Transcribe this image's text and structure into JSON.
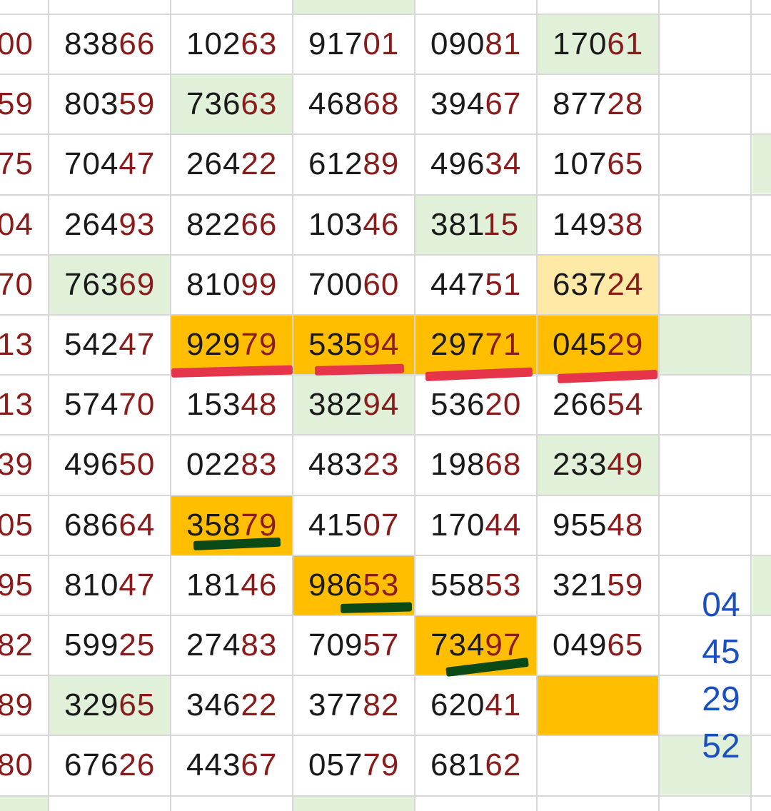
{
  "colors": {
    "grid_line": "#d7d7d7",
    "light_green": "#e1f0d9",
    "light_yellow": "#ffe9a6",
    "orange": "#ffbf00",
    "prefix_text": "#1a1a1a",
    "suffix_text": "#8b1a1a",
    "side_text": "#1a4fbf",
    "red_mark": "#e6354a",
    "green_mark": "#0b4a16"
  },
  "rows": [
    {
      "cells": [
        {
          "pre": "",
          "suf": "00"
        },
        {
          "pre": "838",
          "suf": "66"
        },
        {
          "pre": "102",
          "suf": "63"
        },
        {
          "pre": "917",
          "suf": "01"
        },
        {
          "pre": "090",
          "suf": "81"
        },
        {
          "pre": "170",
          "suf": "61",
          "bg": "light_green"
        }
      ]
    },
    {
      "cells": [
        {
          "pre": "",
          "suf": "59"
        },
        {
          "pre": "803",
          "suf": "59"
        },
        {
          "pre": "736",
          "suf": "63",
          "bg": "light_green"
        },
        {
          "pre": "468",
          "suf": "68"
        },
        {
          "pre": "394",
          "suf": "67"
        },
        {
          "pre": "877",
          "suf": "28"
        }
      ]
    },
    {
      "cells": [
        {
          "pre": "",
          "suf": "75"
        },
        {
          "pre": "704",
          "suf": "47"
        },
        {
          "pre": "264",
          "suf": "22"
        },
        {
          "pre": "612",
          "suf": "89"
        },
        {
          "pre": "496",
          "suf": "34"
        },
        {
          "pre": "107",
          "suf": "65"
        }
      ]
    },
    {
      "cells": [
        {
          "pre": "",
          "suf": "04"
        },
        {
          "pre": "264",
          "suf": "93"
        },
        {
          "pre": "822",
          "suf": "66"
        },
        {
          "pre": "103",
          "suf": "46"
        },
        {
          "pre": "381",
          "suf": "15",
          "bg": "light_green"
        },
        {
          "pre": "149",
          "suf": "38"
        }
      ]
    },
    {
      "cells": [
        {
          "pre": "",
          "suf": "70"
        },
        {
          "pre": "763",
          "suf": "69",
          "bg": "light_green"
        },
        {
          "pre": "810",
          "suf": "99"
        },
        {
          "pre": "700",
          "suf": "60"
        },
        {
          "pre": "447",
          "suf": "51"
        },
        {
          "pre": "637",
          "suf": "24",
          "bg": "light_yellow"
        }
      ]
    },
    {
      "cells": [
        {
          "pre": "",
          "suf": "13"
        },
        {
          "pre": "542",
          "suf": "47"
        },
        {
          "pre": "929",
          "suf": "79",
          "bg": "orange"
        },
        {
          "pre": "535",
          "suf": "94",
          "bg": "orange"
        },
        {
          "pre": "297",
          "suf": "71",
          "bg": "orange"
        },
        {
          "pre": "045",
          "suf": "29",
          "bg": "orange"
        }
      ]
    },
    {
      "cells": [
        {
          "pre": "",
          "suf": "13"
        },
        {
          "pre": "574",
          "suf": "70"
        },
        {
          "pre": "153",
          "suf": "48"
        },
        {
          "pre": "382",
          "suf": "94",
          "bg": "light_green"
        },
        {
          "pre": "536",
          "suf": "20"
        },
        {
          "pre": "266",
          "suf": "54"
        }
      ]
    },
    {
      "cells": [
        {
          "pre": "",
          "suf": "39"
        },
        {
          "pre": "496",
          "suf": "50"
        },
        {
          "pre": "022",
          "suf": "83"
        },
        {
          "pre": "483",
          "suf": "23"
        },
        {
          "pre": "198",
          "suf": "68"
        },
        {
          "pre": "233",
          "suf": "49",
          "bg": "light_green"
        }
      ]
    },
    {
      "cells": [
        {
          "pre": "",
          "suf": "05"
        },
        {
          "pre": "686",
          "suf": "64"
        },
        {
          "pre": "358",
          "suf": "79",
          "bg": "orange"
        },
        {
          "pre": "415",
          "suf": "07"
        },
        {
          "pre": "170",
          "suf": "44"
        },
        {
          "pre": "955",
          "suf": "48"
        }
      ]
    },
    {
      "cells": [
        {
          "pre": "",
          "suf": "95"
        },
        {
          "pre": "810",
          "suf": "47"
        },
        {
          "pre": "181",
          "suf": "46"
        },
        {
          "pre": "986",
          "suf": "53",
          "bg": "orange"
        },
        {
          "pre": "558",
          "suf": "53"
        },
        {
          "pre": "321",
          "suf": "59"
        }
      ]
    },
    {
      "cells": [
        {
          "pre": "",
          "suf": "82"
        },
        {
          "pre": "599",
          "suf": "25"
        },
        {
          "pre": "274",
          "suf": "83"
        },
        {
          "pre": "709",
          "suf": "57"
        },
        {
          "pre": "734",
          "suf": "97",
          "bg": "orange"
        },
        {
          "pre": "049",
          "suf": "65"
        }
      ]
    },
    {
      "cells": [
        {
          "pre": "",
          "suf": "89"
        },
        {
          "pre": "329",
          "suf": "65",
          "bg": "light_green"
        },
        {
          "pre": "346",
          "suf": "22"
        },
        {
          "pre": "377",
          "suf": "82"
        },
        {
          "pre": "620",
          "suf": "41"
        },
        {
          "pre": "",
          "suf": "",
          "bg": "orange"
        }
      ]
    },
    {
      "cells": [
        {
          "pre": "",
          "suf": "80"
        },
        {
          "pre": "676",
          "suf": "26"
        },
        {
          "pre": "443",
          "suf": "67"
        },
        {
          "pre": "057",
          "suf": "79"
        },
        {
          "pre": "681",
          "suf": "62"
        },
        {
          "pre": "",
          "suf": ""
        }
      ]
    }
  ],
  "side_numbers": [
    "04",
    "45",
    "29",
    "52"
  ]
}
